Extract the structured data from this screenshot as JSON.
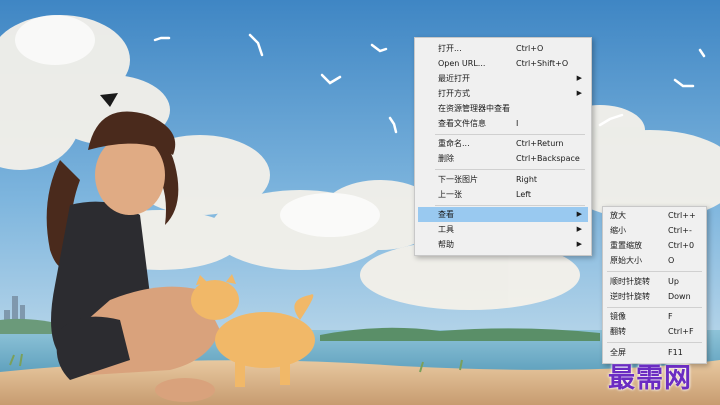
{
  "main_menu": {
    "items": [
      {
        "label": "打开...",
        "shortcut": "Ctrl+O"
      },
      {
        "label": "Open URL...",
        "shortcut": "Ctrl+Shift+O"
      },
      {
        "label": "最近打开",
        "shortcut": ""
      },
      {
        "label": "打开方式",
        "shortcut": ""
      },
      {
        "label": "在资源管理器中查看",
        "shortcut": ""
      },
      {
        "label": "查看文件信息",
        "shortcut": "I"
      },
      {
        "label": "重命名...",
        "shortcut": "Ctrl+Return"
      },
      {
        "label": "删除",
        "shortcut": "Ctrl+Backspace"
      },
      {
        "label": "下一张图片",
        "shortcut": "Right"
      },
      {
        "label": "上一张",
        "shortcut": "Left"
      },
      {
        "label": "查看",
        "shortcut": ""
      },
      {
        "label": "工具",
        "shortcut": ""
      },
      {
        "label": "帮助",
        "shortcut": ""
      }
    ]
  },
  "view_submenu": {
    "items": [
      {
        "label": "放大",
        "shortcut": "Ctrl++"
      },
      {
        "label": "缩小",
        "shortcut": "Ctrl+-"
      },
      {
        "label": "重置缩放",
        "shortcut": "Ctrl+0"
      },
      {
        "label": "原始大小",
        "shortcut": "O"
      },
      {
        "label": "顺时针旋转",
        "shortcut": "Up"
      },
      {
        "label": "逆时针旋转",
        "shortcut": "Down"
      },
      {
        "label": "镜像",
        "shortcut": "F"
      },
      {
        "label": "翻转",
        "shortcut": "Ctrl+F"
      },
      {
        "label": "全屏",
        "shortcut": "F11"
      }
    ]
  },
  "watermark": "最需网",
  "colors": {
    "highlight": "#99c9f0",
    "menu_bg": "#f0f0f0",
    "watermark": "#6b2cc2"
  }
}
